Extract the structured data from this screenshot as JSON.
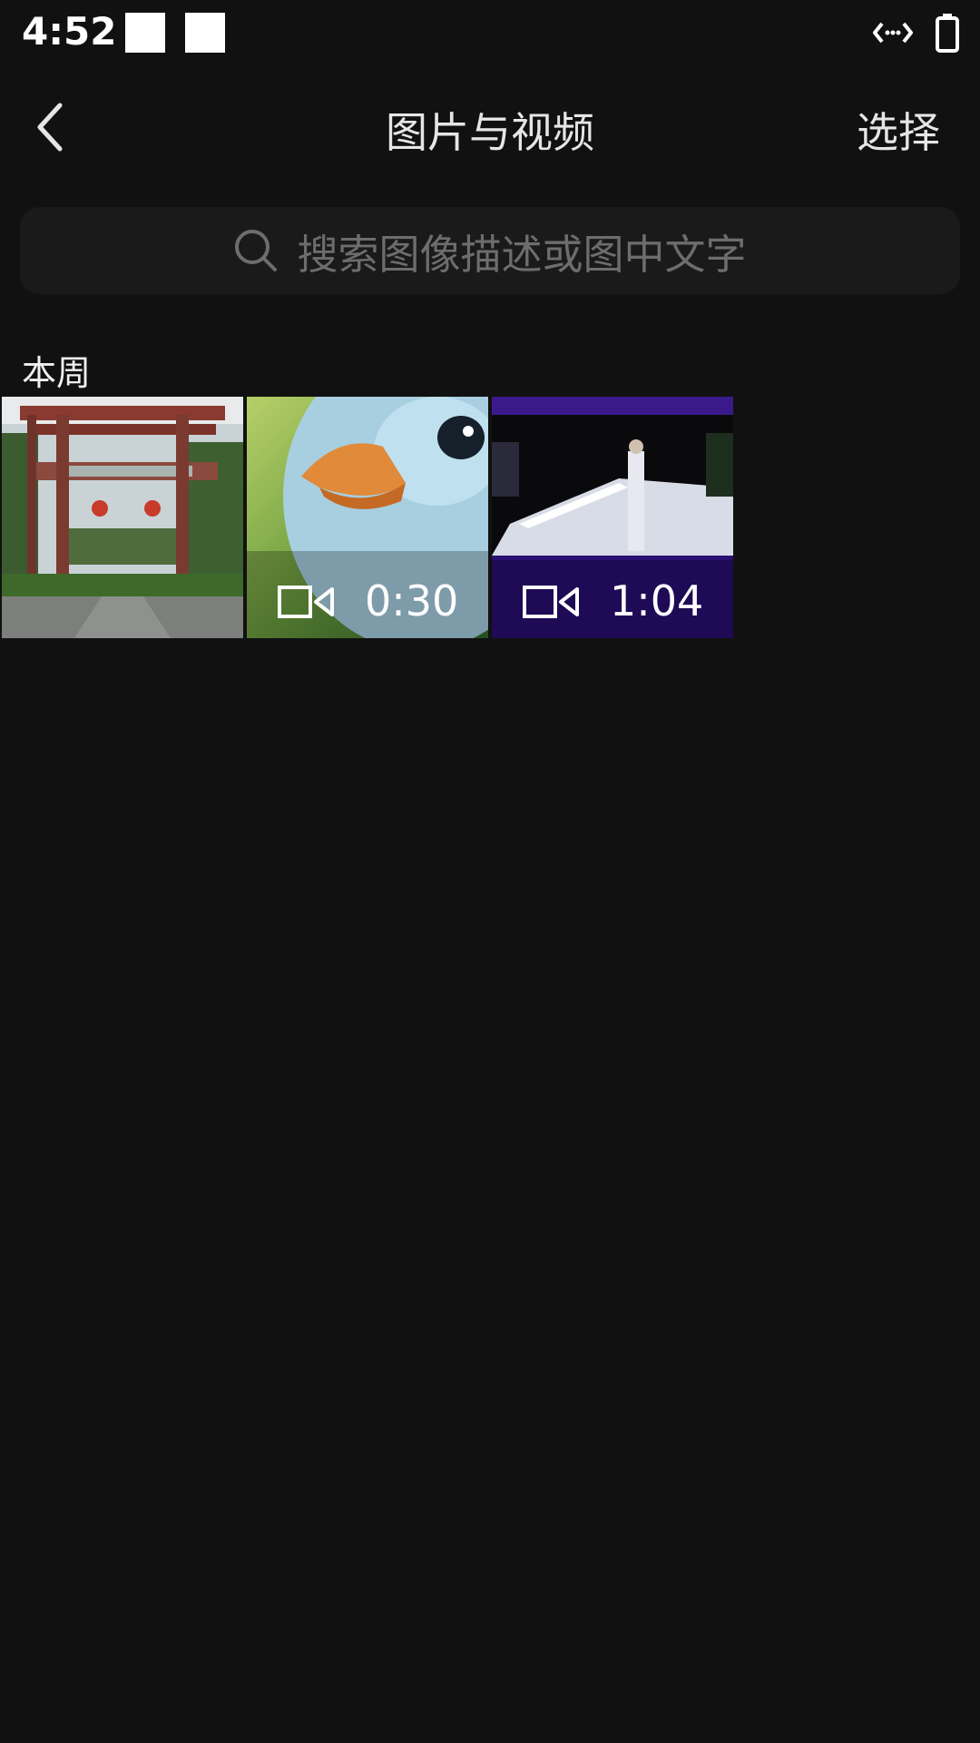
{
  "status_bar": {
    "time": "4:52"
  },
  "header": {
    "title": "图片与视频",
    "select_label": "选择"
  },
  "search": {
    "placeholder": "搜索图像描述或图中文字"
  },
  "section": {
    "label": "本周"
  },
  "items": [
    {
      "type": "image",
      "duration": ""
    },
    {
      "type": "video",
      "duration": "0:30"
    },
    {
      "type": "video",
      "duration": "1:04"
    }
  ]
}
